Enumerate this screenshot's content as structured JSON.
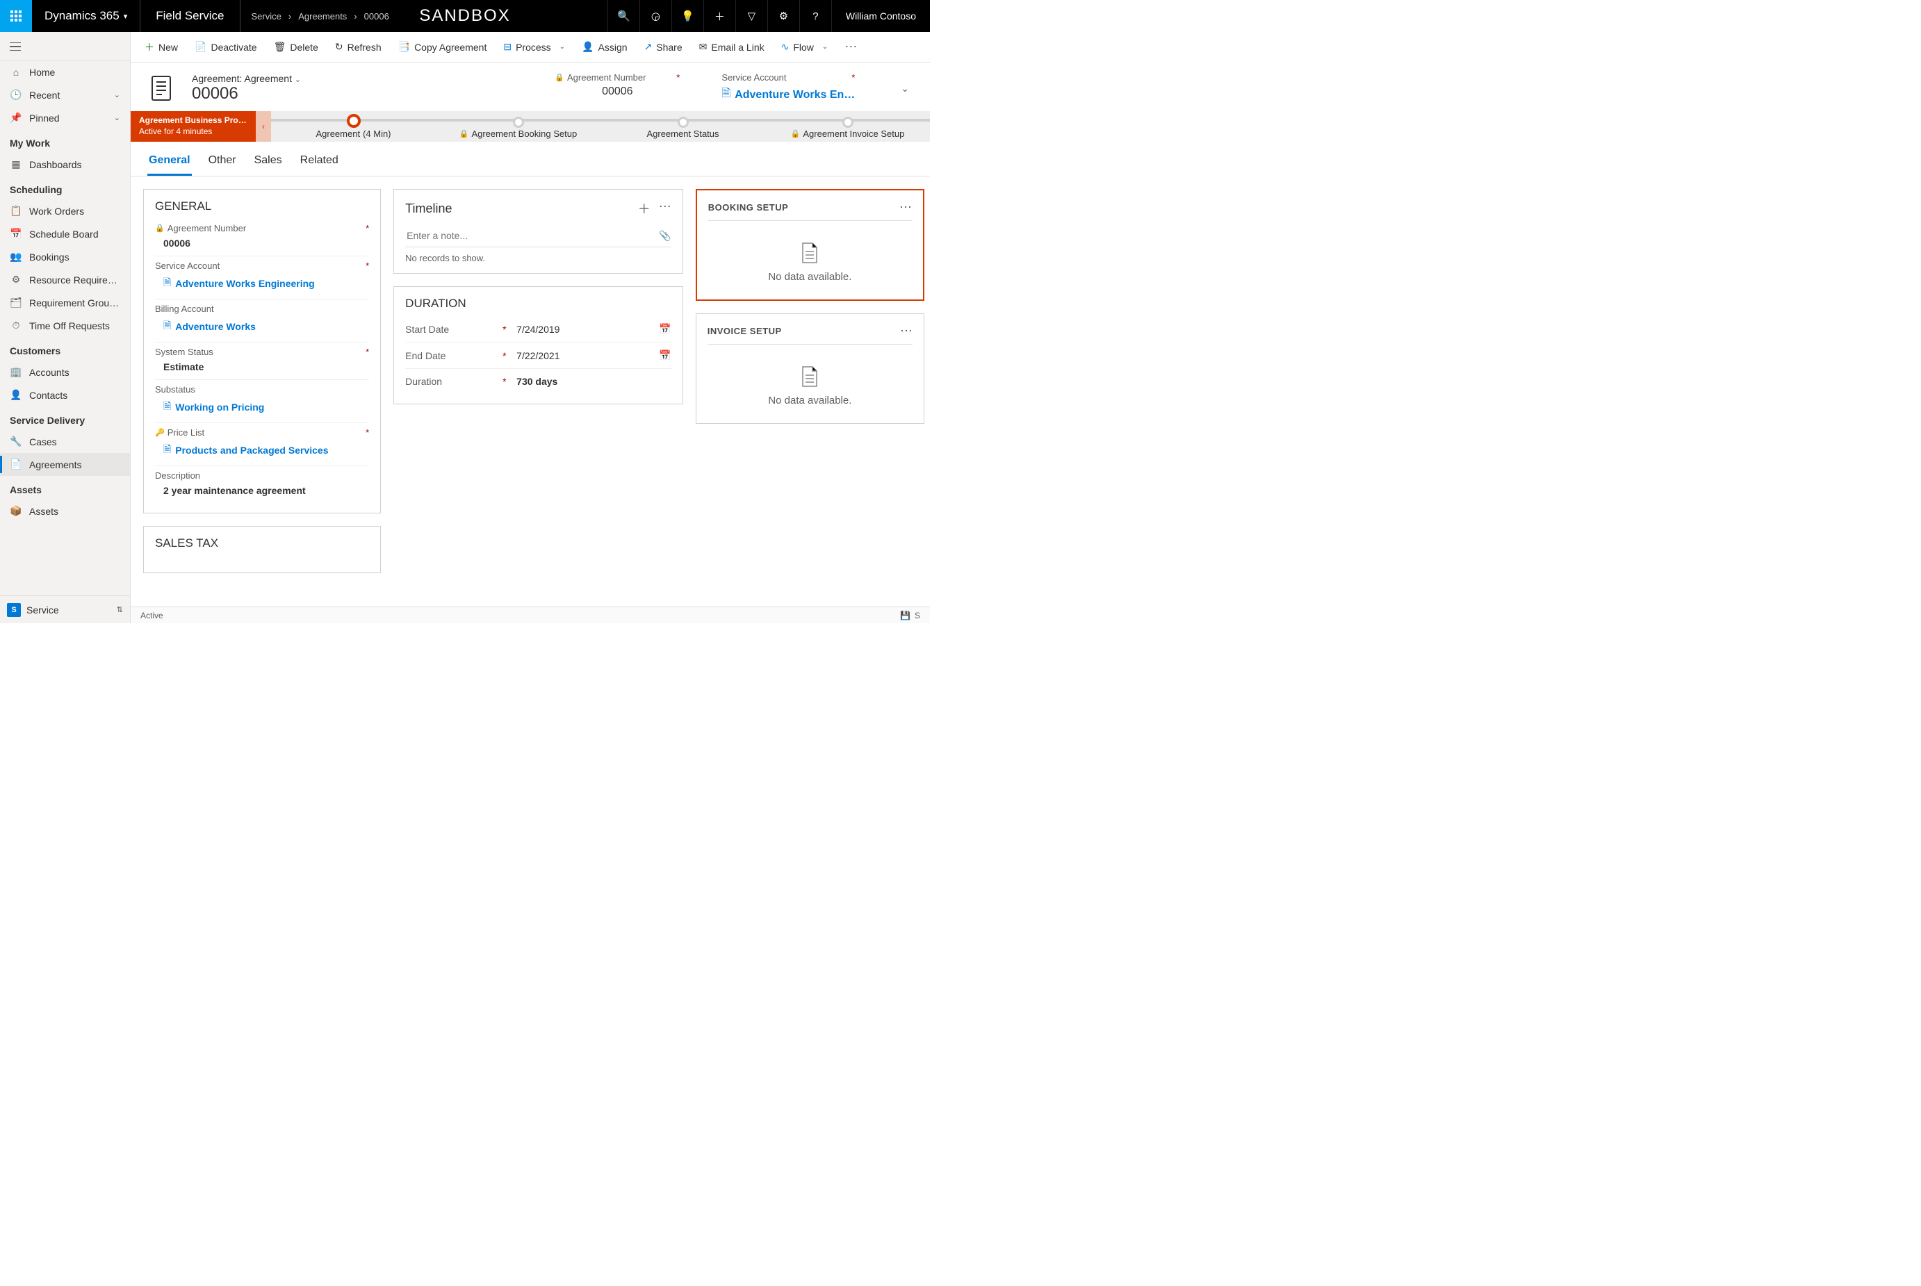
{
  "topbar": {
    "brand": "Dynamics 365",
    "module": "Field Service",
    "crumbs": [
      "Service",
      "Agreements",
      "00006"
    ],
    "center": "SANDBOX",
    "user": "William Contoso"
  },
  "commands": {
    "new": "New",
    "deactivate": "Deactivate",
    "delete": "Delete",
    "refresh": "Refresh",
    "copy": "Copy Agreement",
    "process": "Process",
    "assign": "Assign",
    "share": "Share",
    "emaillink": "Email a Link",
    "flow": "Flow"
  },
  "nav": {
    "home": "Home",
    "recent": "Recent",
    "pinned": "Pinned",
    "sections": {
      "mywork": "My Work",
      "scheduling": "Scheduling",
      "customers": "Customers",
      "servicedelivery": "Service Delivery",
      "assets": "Assets"
    },
    "items": {
      "dashboards": "Dashboards",
      "workorders": "Work Orders",
      "scheduleboard": "Schedule Board",
      "bookings": "Bookings",
      "resreq": "Resource Require…",
      "reqgroup": "Requirement Grou…",
      "timeoff": "Time Off Requests",
      "accounts": "Accounts",
      "contacts": "Contacts",
      "cases": "Cases",
      "agreements": "Agreements",
      "assets": "Assets"
    },
    "area": {
      "badge": "S",
      "label": "Service"
    }
  },
  "formhead": {
    "entity": "Agreement: Agreement",
    "title": "00006",
    "agreementnum_label": "Agreement Number",
    "agreementnum_value": "00006",
    "svcacct_label": "Service Account",
    "svcacct_value": "Adventure Works En…"
  },
  "bpf": {
    "name": "Agreement Business Pro…",
    "subtitle": "Active for 4 minutes",
    "stages": [
      {
        "label": "Agreement",
        "time": "(4 Min)",
        "active": true,
        "locked": false
      },
      {
        "label": "Agreement Booking Setup",
        "time": "",
        "active": false,
        "locked": true
      },
      {
        "label": "Agreement Status",
        "time": "",
        "active": false,
        "locked": false
      },
      {
        "label": "Agreement Invoice Setup",
        "time": "",
        "active": false,
        "locked": true
      }
    ]
  },
  "tabs": {
    "general": "General",
    "other": "Other",
    "sales": "Sales",
    "related": "Related"
  },
  "general": {
    "title": "GENERAL",
    "fields": {
      "agmtnum": {
        "label": "Agreement Number",
        "value": "00006",
        "locked": true,
        "required": true
      },
      "svcacct": {
        "label": "Service Account",
        "value": "Adventure Works Engineering",
        "link": true,
        "required": true
      },
      "billacct": {
        "label": "Billing Account",
        "value": "Adventure Works",
        "link": true,
        "required": false
      },
      "status": {
        "label": "System Status",
        "value": "Estimate",
        "required": true,
        "bold": true
      },
      "substatus": {
        "label": "Substatus",
        "value": "Working on Pricing",
        "link": true
      },
      "pricelist": {
        "label": "Price List",
        "value": "Products and Packaged Services",
        "link": true,
        "required": true,
        "key": true
      },
      "desc": {
        "label": "Description",
        "value": "2 year maintenance agreement",
        "bold": true
      }
    }
  },
  "salestax": {
    "title": "SALES TAX"
  },
  "timeline": {
    "title": "Timeline",
    "placeholder": "Enter a note...",
    "empty": "No records to show."
  },
  "duration": {
    "title": "DURATION",
    "rows": {
      "start": {
        "label": "Start Date",
        "value": "7/24/2019",
        "required": true,
        "cal": true
      },
      "end": {
        "label": "End Date",
        "value": "7/22/2021",
        "required": true,
        "cal": true
      },
      "dur": {
        "label": "Duration",
        "value": "730 days",
        "required": true,
        "bold": true
      }
    }
  },
  "booking": {
    "title": "BOOKING SETUP",
    "empty": "No data available."
  },
  "invoice": {
    "title": "INVOICE SETUP",
    "empty": "No data available."
  },
  "statusbar": {
    "status": "Active",
    "save": "S"
  }
}
